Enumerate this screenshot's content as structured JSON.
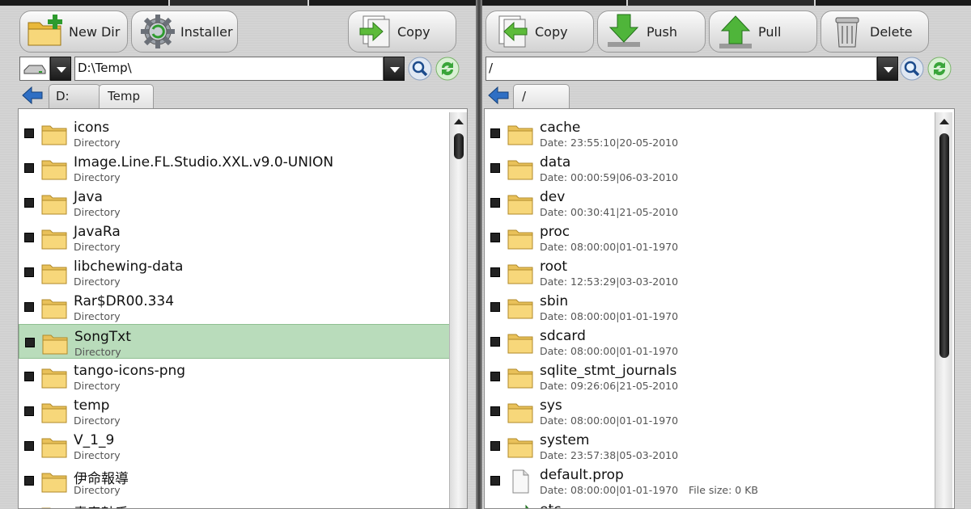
{
  "left": {
    "toolbar": {
      "new_dir": "New Dir",
      "installer": "Installer",
      "copy": "Copy"
    },
    "path": "D:\\Temp\\",
    "tabs": [
      "D:",
      "Temp"
    ],
    "items": [
      {
        "name": "icons",
        "sub": "Directory",
        "type": "folder"
      },
      {
        "name": "Image.Line.FL.Studio.XXL.v9.0-UNION",
        "sub": "Directory",
        "type": "folder"
      },
      {
        "name": "Java",
        "sub": "Directory",
        "type": "folder"
      },
      {
        "name": "JavaRa",
        "sub": "Directory",
        "type": "folder"
      },
      {
        "name": "libchewing-data",
        "sub": "Directory",
        "type": "folder"
      },
      {
        "name": "Rar$DR00.334",
        "sub": "Directory",
        "type": "folder"
      },
      {
        "name": "SongTxt",
        "sub": "Directory",
        "type": "folder",
        "selected": true
      },
      {
        "name": "tango-icons-png",
        "sub": "Directory",
        "type": "folder"
      },
      {
        "name": "temp",
        "sub": "Directory",
        "type": "folder"
      },
      {
        "name": "V_1_9",
        "sub": "Directory",
        "type": "folder"
      },
      {
        "name": "伊命報導",
        "sub": "Directory",
        "type": "folder"
      },
      {
        "name": "青春鼓手",
        "sub": "",
        "type": "folder"
      }
    ]
  },
  "right": {
    "toolbar": {
      "copy": "Copy",
      "push": "Push",
      "pull": "Pull",
      "delete": "Delete"
    },
    "path": "/",
    "tabs": [
      "/"
    ],
    "items": [
      {
        "name": "cache",
        "sub": "Date: 23:55:10|20-05-2010",
        "type": "folder"
      },
      {
        "name": "data",
        "sub": "Date: 00:00:59|06-03-2010",
        "type": "folder"
      },
      {
        "name": "dev",
        "sub": "Date: 00:30:41|21-05-2010",
        "type": "folder"
      },
      {
        "name": "proc",
        "sub": "Date: 08:00:00|01-01-1970",
        "type": "folder"
      },
      {
        "name": "root",
        "sub": "Date: 12:53:29|03-03-2010",
        "type": "folder"
      },
      {
        "name": "sbin",
        "sub": "Date: 08:00:00|01-01-1970",
        "type": "folder"
      },
      {
        "name": "sdcard",
        "sub": "Date: 08:00:00|01-01-1970",
        "type": "folder"
      },
      {
        "name": "sqlite_stmt_journals",
        "sub": "Date: 09:26:06|21-05-2010",
        "type": "folder"
      },
      {
        "name": "sys",
        "sub": "Date: 08:00:00|01-01-1970",
        "type": "folder"
      },
      {
        "name": "system",
        "sub": "Date: 23:57:38|05-03-2010",
        "type": "folder"
      },
      {
        "name": "default.prop",
        "sub": "Date: 08:00:00|01-01-1970",
        "size": "File size: 0 KB",
        "type": "file"
      },
      {
        "name": "etc",
        "sub": "",
        "type": "link"
      }
    ]
  },
  "colors": {
    "selection": "#b9dcbb",
    "folder": "#f7d77a",
    "accent_green": "#3aa53a",
    "accent_blue": "#2f6fc4"
  },
  "icons": [
    "new-folder-icon",
    "installer-gear-icon",
    "copy-right-icon",
    "copy-left-icon",
    "push-down-icon",
    "pull-up-icon",
    "trash-icon",
    "drive-icon",
    "search-icon",
    "refresh-icon",
    "back-arrow-icon",
    "folder-icon",
    "file-icon",
    "link-icon"
  ]
}
